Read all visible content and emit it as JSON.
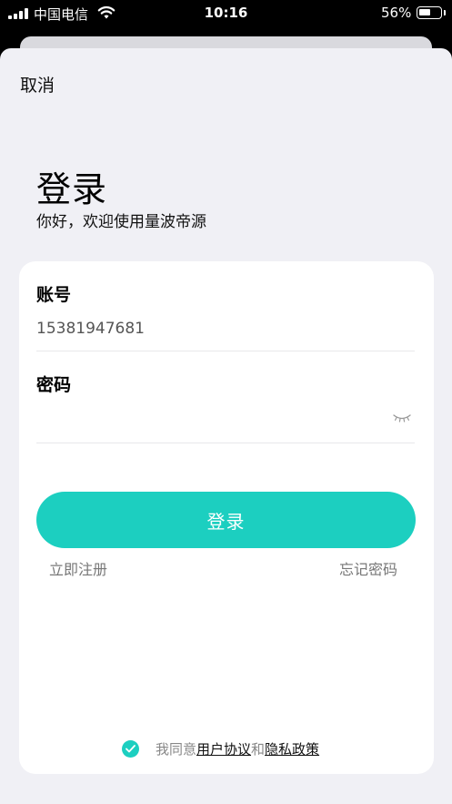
{
  "status_bar": {
    "carrier": "中国电信",
    "time": "10:16",
    "battery": "56%",
    "battery_level": 0.56
  },
  "header": {
    "cancel_label": "取消"
  },
  "login": {
    "title": "登录",
    "subtitle": "你好，欢迎使用量波帝源",
    "account_label": "账号",
    "account_value": "15381947681",
    "password_label": "密码",
    "password_value": "",
    "submit_label": "登录",
    "register_label": "立即注册",
    "forgot_label": "忘记密码"
  },
  "agreement": {
    "prefix": "我同意",
    "user_agreement": "用户协议",
    "and": "和",
    "privacy_policy": "隐私政策",
    "checked": true
  },
  "colors": {
    "accent": "#1ccfc0",
    "background": "#f0f0f5",
    "card": "#ffffff"
  },
  "icons": [
    "signal-icon",
    "wifi-icon",
    "battery-icon",
    "eye-closed-icon",
    "check-icon"
  ]
}
